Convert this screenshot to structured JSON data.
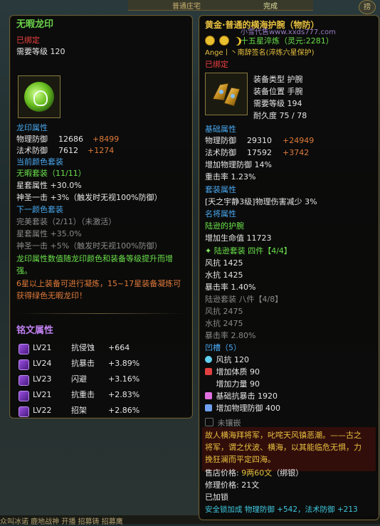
{
  "background": {
    "top_text": "普通庄宅",
    "top_text2": "完成",
    "round_button": "捞",
    "bottom_text": "众叫冰诺   鹿地战神   开播   招募铸   招募鹰"
  },
  "left": {
    "title": "无暇龙印",
    "bound": "已绑定",
    "req_level": "需要等级 120",
    "attr_header": "龙印属性",
    "stats": [
      {
        "label": "物理防御",
        "value": "12686",
        "bonus": "+8499"
      },
      {
        "label": "法术防御",
        "value": "7612",
        "bonus": "+1274"
      }
    ],
    "cur_set_header": "当前颜色套装",
    "cur_set": "无暇套装（11/11）",
    "cur_set_lines": [
      "星套属性 +30.0%",
      "神圣一击 +3%（触发时无视100%防御）"
    ],
    "next_set_header": "下一颜色套装",
    "next_set": "完美套装（2/11）（未激活）",
    "next_set_lines": [
      "星套属性 +35.0%",
      "神圣一击 +5%（触发时无视100%防御）"
    ],
    "desc_green": [
      "龙印属性数值随龙印颜色和装备等级提升而增",
      "强。"
    ],
    "desc_orange": [
      "6星以上装备可进行凝炼，15~17星装备凝炼可",
      "获得绿色无暇龙印！"
    ],
    "insc_header": "铭文属性",
    "inscriptions": [
      {
        "lv": "LV21",
        "name": "抗侵蚀",
        "val": "+664"
      },
      {
        "lv": "LV24",
        "name": "抗暴击",
        "val": "+3.89%"
      },
      {
        "lv": "LV23",
        "name": "闪避",
        "val": "+3.16%"
      },
      {
        "lv": "LV21",
        "name": "抗重击",
        "val": "+2.83%"
      },
      {
        "lv": "LV22",
        "name": "招架",
        "val": "+2.86%"
      }
    ]
  },
  "right": {
    "title": "黄金·普通的横海护腕（物防）",
    "watermark": "小雪代售www.xxds777.com",
    "forge": "十五星淬炼（灵元:2281）",
    "owner": "Ange丨丶南辞签名(淬炼六星保护)",
    "bound": "已绑定",
    "info": [
      "装备类型 护腕",
      "装备位置 手腕",
      "需要等级 194",
      "耐久度 75 / 78"
    ],
    "base_header": "基础属性",
    "base": [
      {
        "label": "物理防御",
        "value": "29310",
        "bonus": "+24949"
      },
      {
        "label": "法术防御",
        "value": "17592",
        "bonus": "+3742"
      }
    ],
    "base_extra": [
      "增加物理防御 14%",
      "重击率  1.23%"
    ],
    "set_header": "套装属性",
    "set_line": "[天之宇静3级]物理伤害减少 3%",
    "famous_header": "名将属性",
    "famous_name": "陆逊的护腕",
    "famous_line": "增加生命值 11723",
    "luxun_set": "陆逊套装  四件【4/4】",
    "luxun_lines": [
      "风抗 1425",
      "水抗 1425",
      "暴击率 1.40%"
    ],
    "luxun8": "陆逊套装  八件【4/8】",
    "luxun8_lines": [
      "风抗 2475",
      "水抗 2475",
      "暴击率 2.80%"
    ],
    "slots_header": "凹槽（5）",
    "slots": [
      "风抗 120",
      "增加体质 90",
      "增加力量 90",
      "基础抗暴击 1920",
      "增加物理防御 400"
    ],
    "unset": "未镶嵌",
    "lore": [
      "故人横海拜将军，叱咤天风镇恶潮。——古之",
      "将军，谓之伏波、横海，以其能临危无惧，力",
      "挽狂澜而平定四海。"
    ],
    "sell_label": "售店价格: ",
    "sell_value": "9两60文",
    "sell_note": "（绑银）",
    "repair": "修理价格: 21文",
    "locked": "已加锁",
    "lock_bonus": "安全锁加成  物理防御 +542，法术防御 +213"
  },
  "colors": {
    "title_green": "#6ad04a",
    "stat_bonus_red": "#f04040",
    "header_blue": "#4aa8f0",
    "set_green": "#6ae04a",
    "title_purple": "#c080f0",
    "gold": "#e8c040"
  }
}
